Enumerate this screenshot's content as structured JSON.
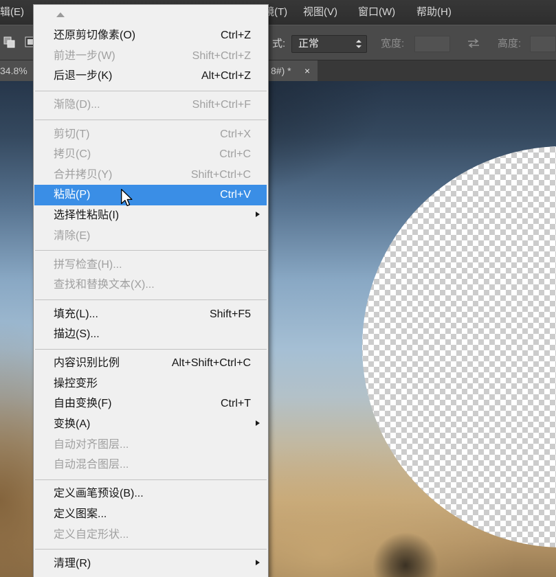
{
  "colors": {
    "menu_highlight": "#3a8ee6",
    "menu_background": "#f0f0f0",
    "disabled_text": "#a0a0a0",
    "checker_light": "#ffffff",
    "checker_dark": "#cccccc"
  },
  "menu_bar": {
    "edit": "辑(E)",
    "filter": "镜(T)",
    "view": "视图(V)",
    "window": "窗口(W)",
    "help": "帮助(H)"
  },
  "options_bar": {
    "style_label": "式:",
    "style_value": "正常",
    "width_label": "宽度:",
    "width_value": "",
    "height_label": "高度:",
    "height_value": ""
  },
  "document_tabs": {
    "zoom_text": "34.8%",
    "active_tab_title": "8#) *",
    "close_glyph": "×"
  },
  "edit_menu": {
    "items": [
      {
        "label": "还原剪切像素(O)",
        "shortcut": "Ctrl+Z",
        "enabled": true
      },
      {
        "label": "前进一步(W)",
        "shortcut": "Shift+Ctrl+Z",
        "enabled": false
      },
      {
        "label": "后退一步(K)",
        "shortcut": "Alt+Ctrl+Z",
        "enabled": true
      },
      {
        "label": "渐隐(D)...",
        "shortcut": "Shift+Ctrl+F",
        "enabled": false
      },
      {
        "label": "剪切(T)",
        "shortcut": "Ctrl+X",
        "enabled": false
      },
      {
        "label": "拷贝(C)",
        "shortcut": "Ctrl+C",
        "enabled": false
      },
      {
        "label": "合并拷贝(Y)",
        "shortcut": "Shift+Ctrl+C",
        "enabled": false
      },
      {
        "label": "粘贴(P)",
        "shortcut": "Ctrl+V",
        "enabled": true,
        "highlighted": true
      },
      {
        "label": "选择性粘贴(I)",
        "enabled": true,
        "submenu": true
      },
      {
        "label": "清除(E)",
        "enabled": false
      },
      {
        "label": "拼写检查(H)...",
        "enabled": false
      },
      {
        "label": "查找和替换文本(X)...",
        "enabled": false
      },
      {
        "label": "填充(L)...",
        "shortcut": "Shift+F5",
        "enabled": true
      },
      {
        "label": "描边(S)...",
        "enabled": true
      },
      {
        "label": "内容识别比例",
        "shortcut": "Alt+Shift+Ctrl+C",
        "enabled": true
      },
      {
        "label": "操控变形",
        "enabled": true
      },
      {
        "label": "自由变换(F)",
        "shortcut": "Ctrl+T",
        "enabled": true
      },
      {
        "label": "变换(A)",
        "enabled": true,
        "submenu": true
      },
      {
        "label": "自动对齐图层...",
        "enabled": false
      },
      {
        "label": "自动混合图层...",
        "enabled": false
      },
      {
        "label": "定义画笔预设(B)...",
        "enabled": true
      },
      {
        "label": "定义图案...",
        "enabled": true
      },
      {
        "label": "定义自定形状...",
        "enabled": false
      },
      {
        "label": "清理(R)",
        "enabled": true,
        "submenu": true
      }
    ]
  }
}
